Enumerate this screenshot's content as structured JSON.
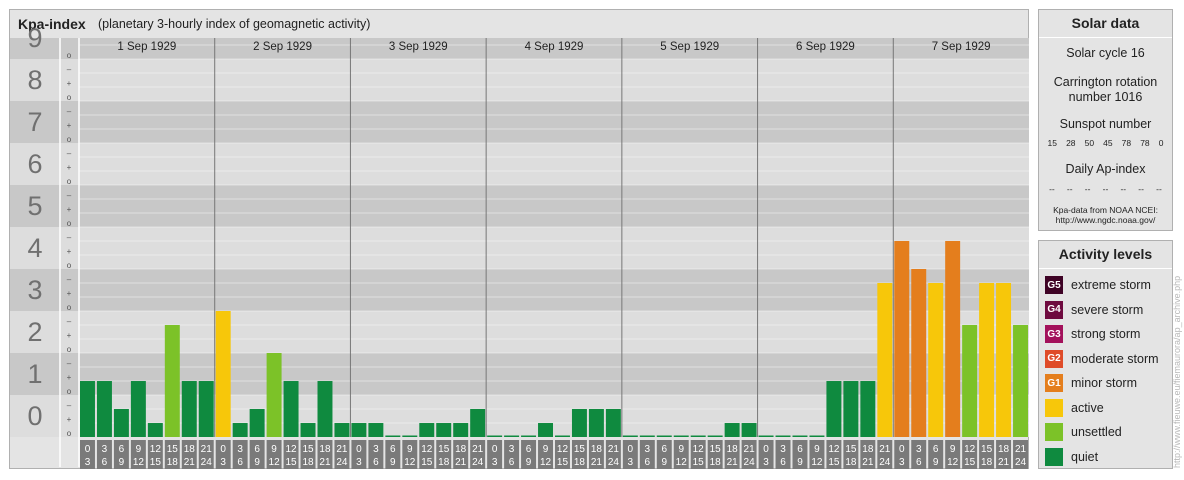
{
  "header": {
    "title": "Kpa-index",
    "subtitle": "(planetary 3-hourly index of geomagnetic activity)"
  },
  "colors": {
    "quiet": "#0f8a3f",
    "unsettled": "#7cc228",
    "active": "#f7c70a",
    "minor": "#e47e1d",
    "moderate": "#df4b28",
    "strong": "#a3115b",
    "severe": "#6e0a3f",
    "extreme": "#3e0325",
    "band_dark": "#c8c8c8",
    "band_light": "#dddddd",
    "tick_box": "#7a7a7a"
  },
  "chart_data": {
    "type": "bar",
    "title": "Kpa-index",
    "ylim": [
      0,
      9
    ],
    "y_ticks": [
      "0",
      "1",
      "2",
      "3",
      "4",
      "5",
      "6",
      "7",
      "8",
      "9"
    ],
    "sub_ticks": [
      "o",
      "+",
      "–"
    ],
    "days": [
      "1 Sep 1929",
      "2 Sep 1929",
      "3 Sep 1929",
      "4 Sep 1929",
      "5 Sep 1929",
      "6 Sep 1929",
      "7 Sep 1929"
    ],
    "interval_start": [
      "0",
      "3",
      "6",
      "9",
      "12",
      "15",
      "18",
      "21"
    ],
    "interval_end": [
      "3",
      "6",
      "9",
      "12",
      "15",
      "18",
      "21",
      "24"
    ],
    "values": [
      [
        1.333,
        1.333,
        0.667,
        1.333,
        0.333,
        2.667,
        1.333,
        1.333
      ],
      [
        3.0,
        0.333,
        0.667,
        2.0,
        1.333,
        0.333,
        1.333,
        0.333
      ],
      [
        0.333,
        0.333,
        0,
        0,
        0.333,
        0.333,
        0.333,
        0.667
      ],
      [
        0,
        0,
        0,
        0.333,
        0,
        0.667,
        0.667,
        0.667
      ],
      [
        0,
        0,
        0,
        0,
        0,
        0,
        0.333,
        0.333
      ],
      [
        0,
        0,
        0,
        0,
        1.333,
        1.333,
        1.333,
        3.667
      ],
      [
        4.667,
        4.0,
        3.667,
        4.667,
        2.667,
        3.667,
        3.667,
        2.667
      ]
    ]
  },
  "solar": {
    "title": "Solar data",
    "cycle": "Solar cycle 16",
    "carrington_line1": "Carrington rotation",
    "carrington_line2": "number 1016",
    "sunspot_label": "Sunspot number",
    "sunspot_values": [
      "15",
      "28",
      "50",
      "45",
      "78",
      "78",
      "0"
    ],
    "ap_label": "Daily Ap-index",
    "ap_values": [
      "--",
      "--",
      "--",
      "--",
      "--",
      "--",
      "--"
    ],
    "source_line1": "Kpa-data from NOAA NCEI:",
    "source_line2": "http://www.ngdc.noaa.gov/"
  },
  "activity": {
    "title": "Activity levels",
    "levels": [
      {
        "code": "G5",
        "label": "extreme storm",
        "color": "#3e0325"
      },
      {
        "code": "G4",
        "label": "severe storm",
        "color": "#6e0a3f"
      },
      {
        "code": "G3",
        "label": "strong storm",
        "color": "#a3115b"
      },
      {
        "code": "G2",
        "label": "moderate storm",
        "color": "#df4b28"
      },
      {
        "code": "G1",
        "label": "minor storm",
        "color": "#e47e1d"
      },
      {
        "code": "",
        "label": "active",
        "color": "#f7c70a"
      },
      {
        "code": "",
        "label": "unsettled",
        "color": "#7cc228"
      },
      {
        "code": "",
        "label": "quiet",
        "color": "#0f8a3f"
      }
    ]
  },
  "watermark": "http://www.fieuwe.eu/fiemaurora/ap_archive.php"
}
